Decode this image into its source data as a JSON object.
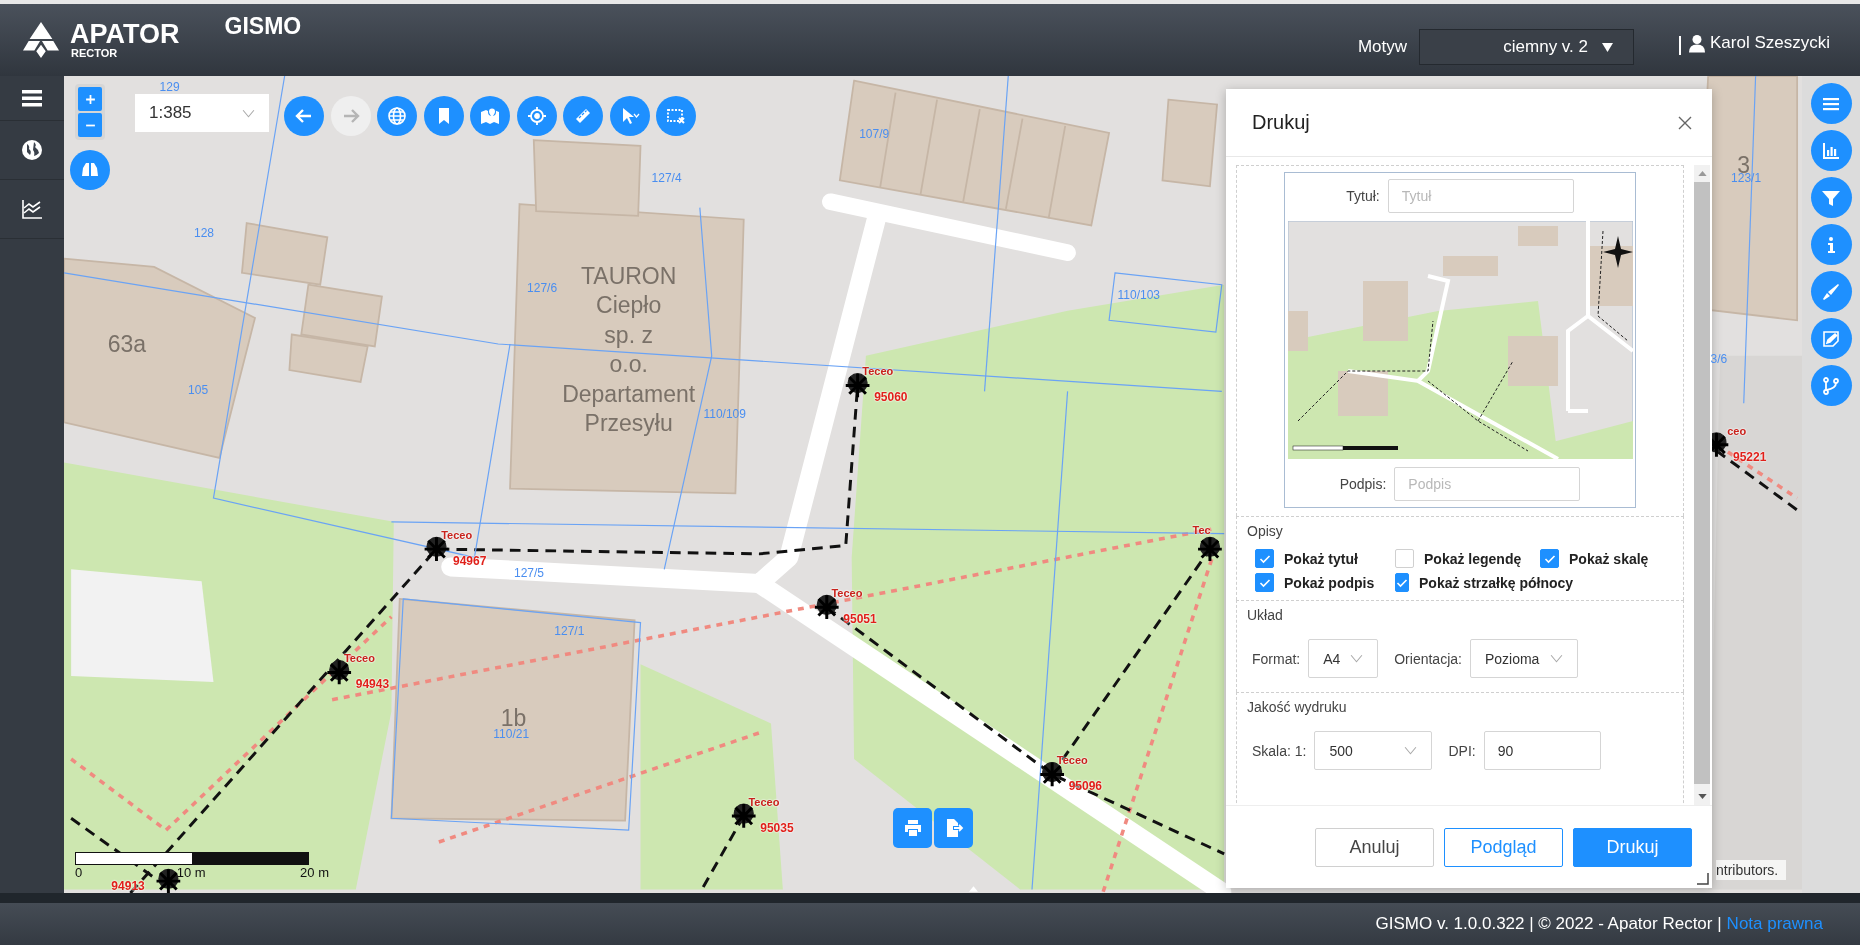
{
  "header": {
    "logo": {
      "name": "APATOR",
      "sub": "RECTOR"
    },
    "app_title": "GISMO",
    "theme_label": "Motyw",
    "theme_value": "ciemny v. 2",
    "user": "Karol Szeszycki"
  },
  "sidebar": {
    "items": [
      {
        "kind": "menu"
      },
      {
        "kind": "globe"
      },
      {
        "kind": "chart"
      }
    ]
  },
  "map_toolbar": {
    "scale": "1:385",
    "tools": [
      {
        "kind": "back",
        "disabled": false
      },
      {
        "kind": "forward",
        "disabled": true
      },
      {
        "kind": "globe",
        "disabled": false
      },
      {
        "kind": "bookmark",
        "disabled": false
      },
      {
        "kind": "map",
        "disabled": false
      },
      {
        "kind": "target",
        "disabled": false
      },
      {
        "kind": "ruler",
        "disabled": false
      },
      {
        "kind": "select",
        "disabled": false
      },
      {
        "kind": "clear",
        "disabled": false
      }
    ]
  },
  "right_toolbar": [
    {
      "kind": "menu"
    },
    {
      "kind": "chart"
    },
    {
      "kind": "filter"
    },
    {
      "kind": "info"
    },
    {
      "kind": "pen"
    },
    {
      "kind": "edit"
    },
    {
      "kind": "branch"
    }
  ],
  "map": {
    "labels": [
      {
        "kind": "parcel",
        "text": "129"
      },
      {
        "kind": "parcel",
        "text": "107/9"
      },
      {
        "kind": "parcel",
        "text": "127/4"
      },
      {
        "kind": "parcel",
        "text": "128"
      },
      {
        "kind": "parcel",
        "text": "127/6"
      },
      {
        "kind": "building",
        "text": "63a"
      },
      {
        "kind": "building",
        "lines": [
          "TAURON",
          "Ciepło",
          "sp. z",
          "o.o.",
          "Departament",
          "Przesyłu"
        ]
      },
      {
        "kind": "parcel",
        "text": "105"
      },
      {
        "kind": "parcel",
        "text": "110/109"
      },
      {
        "kind": "parcel",
        "text": "110/103"
      },
      {
        "kind": "parcel",
        "text": "127/5"
      },
      {
        "kind": "parcel",
        "text": "127/1"
      },
      {
        "kind": "building",
        "text": "1b"
      },
      {
        "kind": "parcel",
        "text": "110/21"
      },
      {
        "kind": "building",
        "text": "3"
      },
      {
        "kind": "parcel",
        "text": "123/1"
      },
      {
        "kind": "parcel",
        "text": "3/6"
      }
    ],
    "markers": [
      {
        "label": "Teceo",
        "id": "94967"
      },
      {
        "label": "Teceo",
        "id": "95060"
      },
      {
        "label": "Teceo",
        "id": "95051"
      },
      {
        "label": "Teceo",
        "id": "94943"
      },
      {
        "label": "Teceo",
        "id": "95096"
      },
      {
        "label": "Teceo",
        "id": "95035"
      },
      {
        "id": "94913"
      },
      {
        "label": "Tec"
      },
      {
        "label": "ceo",
        "id": "95221"
      }
    ],
    "scale_bar": [
      "0",
      "10 m",
      "20 m"
    ],
    "attribution": "ntributors."
  },
  "print_dialog": {
    "title": "Drukuj",
    "title_label": "Tytuł:",
    "title_placeholder": "Tytuł",
    "caption_label": "Podpis:",
    "caption_placeholder": "Podpis",
    "descriptions": {
      "heading": "Opisy",
      "options": [
        {
          "label": "Pokaż tytuł",
          "checked": true
        },
        {
          "label": "Pokaż legendę",
          "checked": false
        },
        {
          "label": "Pokaż skalę",
          "checked": true
        },
        {
          "label": "Pokaż podpis",
          "checked": true
        },
        {
          "label": "Pokaż strzałkę północy",
          "checked": true
        }
      ]
    },
    "layout": {
      "heading": "Układ",
      "format_label": "Format:",
      "format": "A4",
      "orientation_label": "Orientacja:",
      "orientation": "Pozioma"
    },
    "quality": {
      "heading": "Jakość wydruku",
      "scale_label": "Skala: 1:",
      "scale": "500",
      "dpi_label": "DPI:",
      "dpi": "90"
    },
    "buttons": [
      {
        "kind": "cancel",
        "label": "Anuluj"
      },
      {
        "kind": "preview",
        "label": "Podgląd"
      },
      {
        "kind": "primary",
        "label": "Drukuj"
      }
    ]
  },
  "footer": {
    "text": "GISMO v. 1.0.0.322 | © 2022 - Apator Rector |",
    "link": "Nota prawna"
  }
}
